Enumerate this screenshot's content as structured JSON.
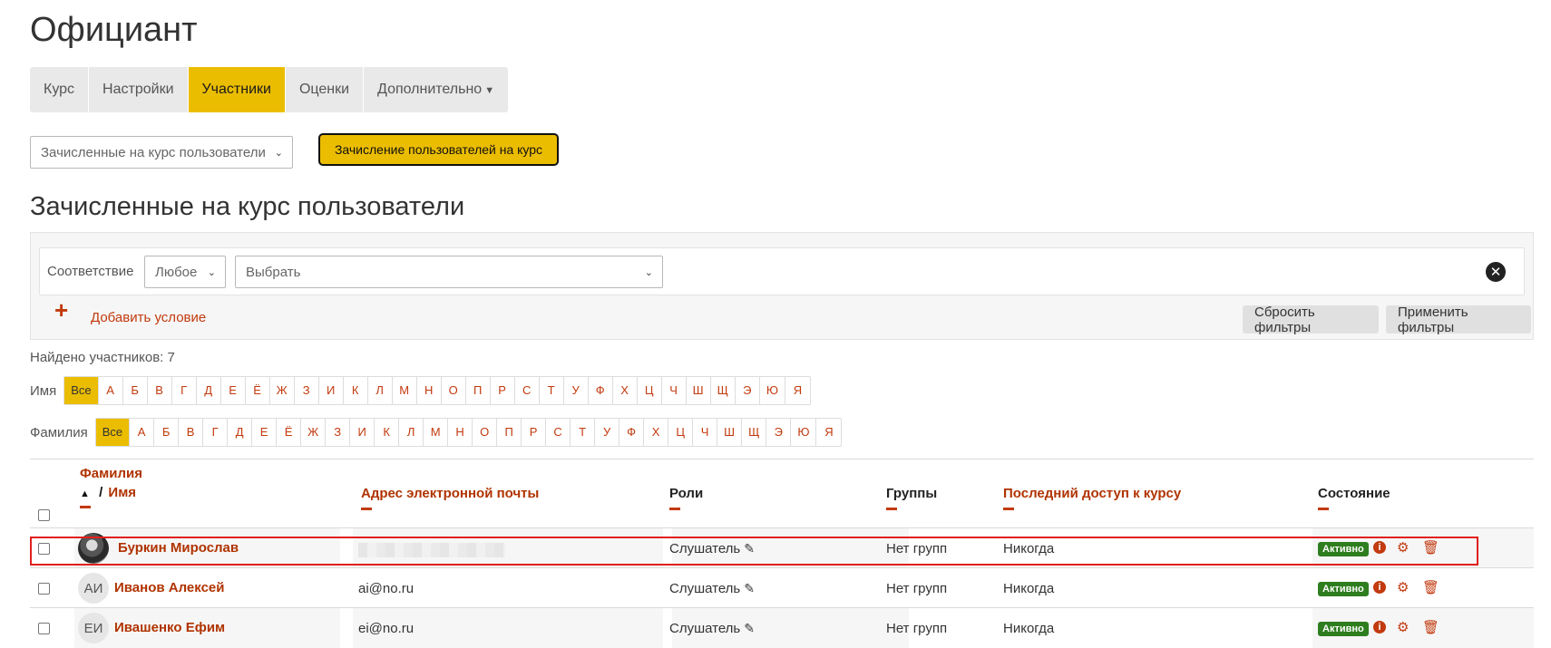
{
  "page": {
    "title": "Официант"
  },
  "nav": {
    "tabs": [
      {
        "label": "Курс"
      },
      {
        "label": "Настройки"
      },
      {
        "label": "Участники"
      },
      {
        "label": "Оценки"
      },
      {
        "label": "Дополнительно"
      }
    ],
    "active_tab": "Участники"
  },
  "enrol": {
    "select_value": "Зачисленные на курс пользователи",
    "button_label": "Зачисление пользователей на курс"
  },
  "section": {
    "title": "Зачисленные на курс пользователи"
  },
  "filter": {
    "match_label": "Соответствие",
    "match_value": "Любое",
    "choose_placeholder": "Выбрать",
    "add_condition": "Добавить условие",
    "reset_label": "Сбросить фильтры",
    "apply_label": "Применить фильтры"
  },
  "found_text": "Найдено участников: 7",
  "initials": {
    "firstname_label": "Имя",
    "lastname_label": "Фамилия",
    "all_label": "Все",
    "letters": [
      "А",
      "Б",
      "В",
      "Г",
      "Д",
      "Е",
      "Ё",
      "Ж",
      "З",
      "И",
      "К",
      "Л",
      "М",
      "Н",
      "О",
      "П",
      "Р",
      "С",
      "Т",
      "У",
      "Ф",
      "Х",
      "Ц",
      "Ч",
      "Ш",
      "Щ",
      "Э",
      "Ю",
      "Я"
    ]
  },
  "table": {
    "headers": {
      "lastname": "Фамилия",
      "name_separator": "/",
      "firstname": "Имя",
      "email": "Адрес электронной почты",
      "roles": "Роли",
      "groups": "Группы",
      "last_access": "Последний доступ к курсу",
      "status": "Состояние"
    },
    "rows": [
      {
        "name": "Буркин Мирослав",
        "initials": "",
        "email": "",
        "role": "Слушатель",
        "groups": "Нет групп",
        "last_access": "Никогда",
        "status": "Активно"
      },
      {
        "name": "Иванов Алексей",
        "initials": "АИ",
        "email": "ai@no.ru",
        "role": "Слушатель",
        "groups": "Нет групп",
        "last_access": "Никогда",
        "status": "Активно"
      },
      {
        "name": "Ивашенко Ефим",
        "initials": "ЕИ",
        "email": "ei@no.ru",
        "role": "Слушатель",
        "groups": "Нет групп",
        "last_access": "Никогда",
        "status": "Активно"
      }
    ]
  },
  "icons": {
    "chevron": "chevron-down-icon",
    "clear": "close-circle-icon",
    "add": "plus-icon",
    "sort": "sort-ascending-icon",
    "edit": "pencil-icon",
    "info": "info-icon",
    "settings": "gear-icon",
    "delete": "trash-icon"
  },
  "colors": {
    "accent": "#ebbd00",
    "link": "#c23a0e",
    "status_active": "#2e7d1e",
    "highlight": "#e0201f"
  }
}
